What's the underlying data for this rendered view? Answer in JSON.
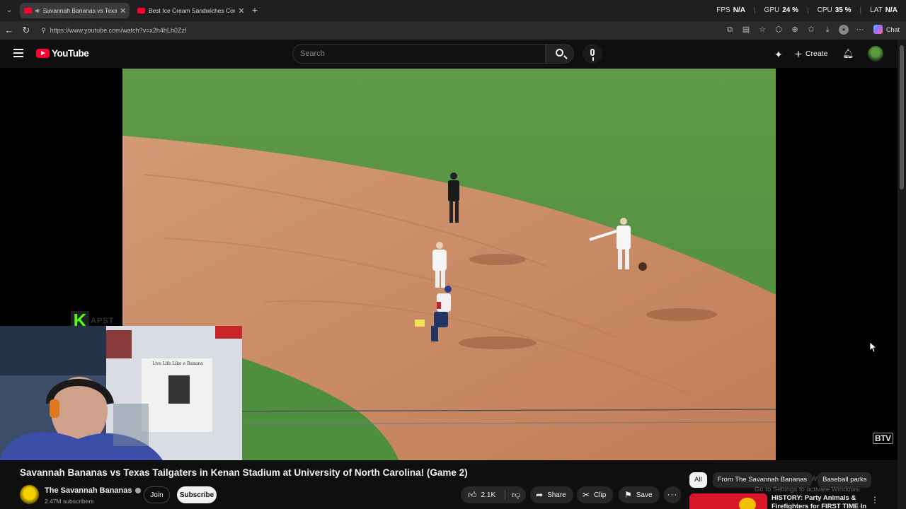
{
  "browser": {
    "tabs": [
      {
        "title": "Savannah Bananas vs Texas Tailgaters",
        "active": true,
        "audio": true
      },
      {
        "title": "Best Ice Cream Sandwiches Comp",
        "active": false,
        "audio": false
      }
    ],
    "url": "https://www.youtube.com/watch?v=x2h4hLh0ZzI",
    "perf": {
      "fps_label": "FPS",
      "fps_value": "N/A",
      "gpu_label": "GPU",
      "gpu_value": "24 %",
      "cpu_label": "CPU",
      "cpu_value": "35 %",
      "lat_label": "LAT",
      "lat_value": "N/A"
    },
    "chat_label": "Chat"
  },
  "youtube": {
    "logo_text": "YouTube",
    "search_placeholder": "Search",
    "create_label": "Create"
  },
  "video": {
    "title": "Savannah Bananas vs Texas Tailgaters in Kenan Stadium at University of North Carolina! (Game 2)",
    "watermark": "BTV",
    "overlay_logo": "K",
    "overlay_text": "APST",
    "shirt_text": "Live Life Like a Banana"
  },
  "channel": {
    "name": "The Savannah Bananas",
    "subscribers": "2.47M subscribers",
    "join_label": "Join",
    "subscribe_label": "Subscribe"
  },
  "actions": {
    "likes": "2.1K",
    "share": "Share",
    "clip": "Clip",
    "save": "Save",
    "more": "···"
  },
  "sidebar": {
    "chips": [
      "All",
      "From The Savannah Bananas",
      "Baseball parks"
    ],
    "recommended_title": "HISTORY: Party Animals & Firefighters for FIRST TIME In",
    "activation_title": "Activate Windows",
    "activation_sub": "Go to Settings to activate Windows."
  },
  "colors": {
    "brand_red": "#ff0033",
    "kick_green": "#53fc18",
    "background": "#0f0f0f"
  }
}
